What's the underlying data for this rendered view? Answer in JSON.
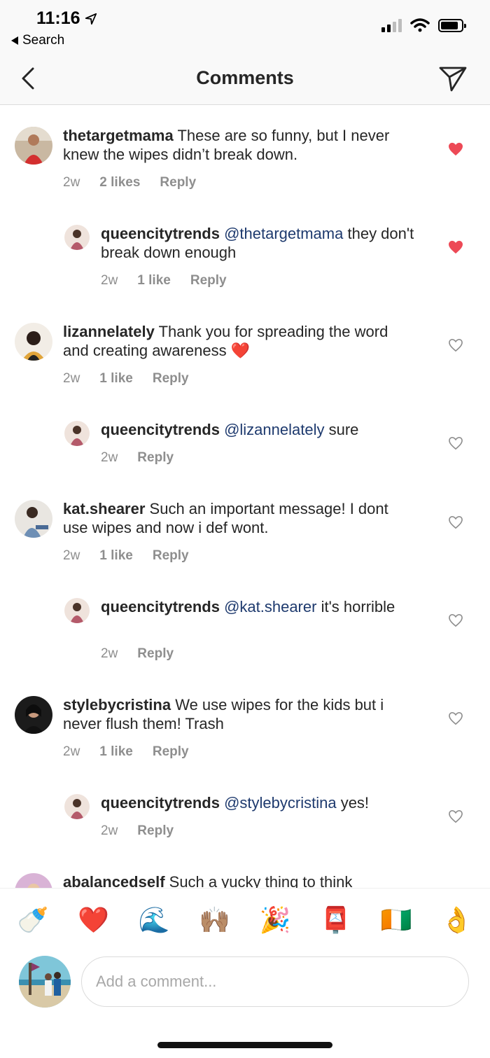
{
  "status_bar": {
    "time": "11:16",
    "back_app": "Search"
  },
  "header": {
    "title": "Comments"
  },
  "comments": [
    {
      "kind": "top",
      "username": "thetargetmama",
      "mention": "",
      "text": "These are so funny, but I never knew the wipes didn’t break down.",
      "age": "2w",
      "likes": "2 likes",
      "reply": "Reply",
      "liked": true
    },
    {
      "kind": "reply",
      "username": "queencitytrends",
      "mention": "@thetargetmama",
      "text": "they don't break down enough",
      "age": "2w",
      "likes": "1 like",
      "reply": "Reply",
      "liked": true
    },
    {
      "kind": "top",
      "username": "lizannelately",
      "mention": "",
      "text": "Thank you for spreading the word and creating awareness ❤️",
      "age": "2w",
      "likes": "1 like",
      "reply": "Reply",
      "liked": false
    },
    {
      "kind": "reply",
      "username": "queencitytrends",
      "mention": "@lizannelately",
      "text": "sure",
      "age": "2w",
      "likes": "",
      "reply": "Reply",
      "liked": false
    },
    {
      "kind": "top",
      "username": "kat.shearer",
      "mention": "",
      "text": "Such an important message! I dont use wipes and now i def wont.",
      "age": "2w",
      "likes": "1 like",
      "reply": "Reply",
      "liked": false
    },
    {
      "kind": "reply",
      "username": "queencitytrends",
      "mention": "@kat.shearer",
      "text": "it's horrible",
      "age": "2w",
      "likes": "",
      "reply": "Reply",
      "liked": false
    },
    {
      "kind": "top",
      "username": "stylebycristina",
      "mention": "",
      "text": "We use wipes for the kids but i never flush them! Trash",
      "age": "2w",
      "likes": "1 like",
      "reply": "Reply",
      "liked": false
    },
    {
      "kind": "reply",
      "username": "queencitytrends",
      "mention": "@stylebycristina",
      "text": "yes!",
      "age": "2w",
      "likes": "",
      "reply": "Reply",
      "liked": false
    },
    {
      "kind": "top",
      "username": "abalancedself",
      "mention": "",
      "text": "Such a yucky thing to think",
      "age": "",
      "likes": "",
      "reply": "",
      "liked": false
    }
  ],
  "emoji_bar": [
    {
      "char": "🍼",
      "name": "baby-bottle-emoji"
    },
    {
      "char": "❤️",
      "name": "red-heart-emoji"
    },
    {
      "char": "🌊",
      "name": "wave-emoji"
    },
    {
      "char": "🙌🏽",
      "name": "raising-hands-emoji"
    },
    {
      "char": "🎉",
      "name": "party-popper-emoji"
    },
    {
      "char": "📮",
      "name": "postbox-emoji"
    },
    {
      "char": "🇨🇮",
      "name": "flag-emoji"
    },
    {
      "char": "👌",
      "name": "ok-hand-emoji"
    }
  ],
  "composer": {
    "placeholder": "Add a comment..."
  },
  "colors": {
    "liked_heart": "#ed4956",
    "mention": "#1e3a6e",
    "meta": "#8e8e8e",
    "text": "#262626"
  },
  "icons": {
    "back": "chevron-left-icon",
    "send": "paper-plane-icon",
    "heart_filled": "heart-filled-icon",
    "heart_outline": "heart-outline-icon"
  }
}
